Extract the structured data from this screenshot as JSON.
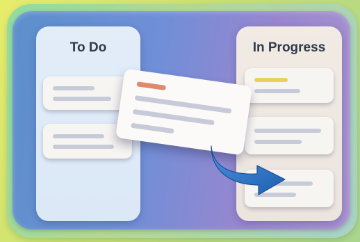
{
  "board": {
    "columns": [
      {
        "id": "todo",
        "title": "To Do"
      },
      {
        "id": "in-progress",
        "title": "In Progress"
      }
    ]
  },
  "colors": {
    "priority_red": "#e08a6c",
    "priority_yellow": "#e7d25e",
    "arrow_blue": "#2f78c9"
  },
  "icons": {
    "move_arrow": "curved-arrow-right-icon"
  }
}
